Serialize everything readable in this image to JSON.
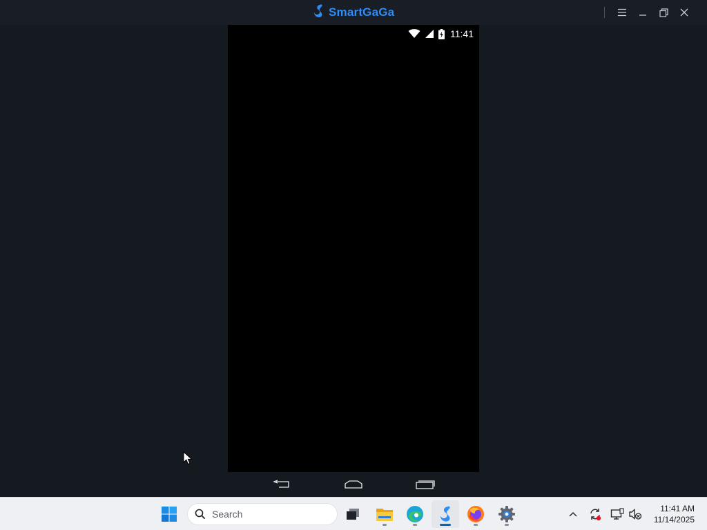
{
  "window": {
    "app_name": "SmartGaGa",
    "brand_color": "#2f8df3",
    "controls": [
      "menu-icon",
      "minimize-icon",
      "restore-icon",
      "close-icon"
    ]
  },
  "android": {
    "status_time": "11:41",
    "status_icons": [
      "wifi-icon",
      "cell-signal-icon",
      "battery-charging-icon"
    ],
    "nav_buttons": [
      "back-icon",
      "home-icon",
      "recents-icon"
    ]
  },
  "taskbar": {
    "search_placeholder": "Search",
    "pinned_apps": [
      "windows-start-icon",
      "task-view-icon",
      "file-explorer-icon",
      "edge-icon",
      "smartgaga-icon",
      "firefox-icon",
      "settings-icon"
    ],
    "active_app": "smartgaga-icon",
    "tray_icons": [
      "chevron-up-icon",
      "sync-icon",
      "display-icon",
      "volume-muted-icon"
    ],
    "clock_time": "11:41 AM",
    "clock_date": "11/14/2025"
  }
}
